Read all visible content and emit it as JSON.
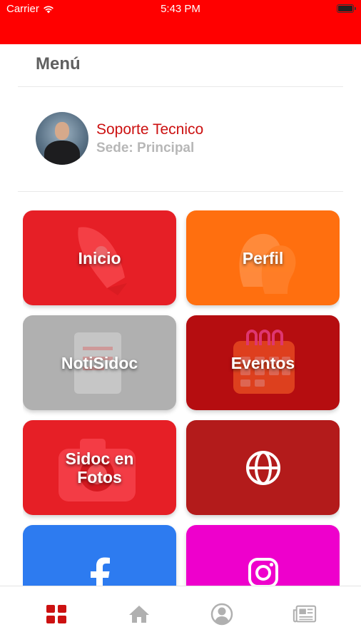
{
  "status_bar": {
    "carrier": "Carrier",
    "time": "5:43 PM",
    "wifi_icon": "wifi-icon",
    "battery_icon": "battery-icon"
  },
  "header": {
    "title": "Menú"
  },
  "profile": {
    "name": "Soporte Tecnico",
    "sede": "Sede: Principal",
    "avatar_icon": "avatar"
  },
  "tiles": [
    {
      "label": "Inicio",
      "color": "#e61f26",
      "art_icon": "rocket-icon"
    },
    {
      "label": "Perfil",
      "color": "#ff6f0f",
      "art_icon": "heads-icon"
    },
    {
      "label": "NotiSidoc",
      "color": "#b0b0b0",
      "art_icon": "document-icon"
    },
    {
      "label": "Eventos",
      "color": "#b50d10",
      "art_icon": "calendar-icon"
    },
    {
      "label_line1": "Sidoc en",
      "label_line2": "Fotos",
      "color": "#e61f26",
      "art_icon": "camera-icon"
    },
    {
      "label": "",
      "color": "#b31b1b",
      "art_icon": "globe-icon"
    },
    {
      "label": "",
      "color": "#2d7bf0",
      "art_icon": "facebook-icon"
    },
    {
      "label": "",
      "color": "#ee00cc",
      "art_icon": "instagram-icon"
    }
  ],
  "tabbar": {
    "active_color": "#cc1111",
    "inactive_color": "#b0b0b0",
    "items": [
      {
        "icon": "grid-icon",
        "active": true
      },
      {
        "icon": "home-icon",
        "active": false
      },
      {
        "icon": "user-icon",
        "active": false
      },
      {
        "icon": "newspaper-icon",
        "active": false
      }
    ]
  }
}
